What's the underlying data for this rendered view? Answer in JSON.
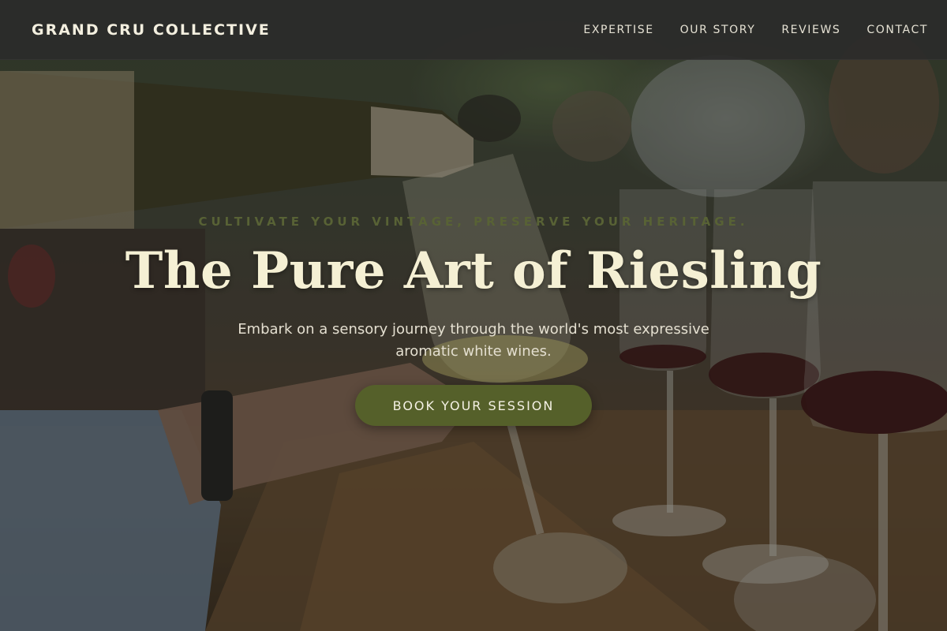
{
  "brand": {
    "name": "GRAND CRU COLLECTIVE"
  },
  "nav": {
    "links": [
      {
        "label": "EXPERTISE"
      },
      {
        "label": "OUR STORY"
      },
      {
        "label": "REVIEWS"
      },
      {
        "label": "CONTACT"
      }
    ]
  },
  "hero": {
    "eyebrow": "CULTIVATE YOUR VINTAGE, PRESERVE YOUR HERITAGE.",
    "title": "The Pure Art of Riesling",
    "subtitle": "Embark on a sensory journey through the world's most expressive aromatic white wines.",
    "cta_label": "BOOK YOUR SESSION"
  },
  "colors": {
    "nav_background": "#2c2c2a",
    "title": "#f5f0d4",
    "eyebrow": "#586235",
    "cta_background": "#55602a"
  }
}
